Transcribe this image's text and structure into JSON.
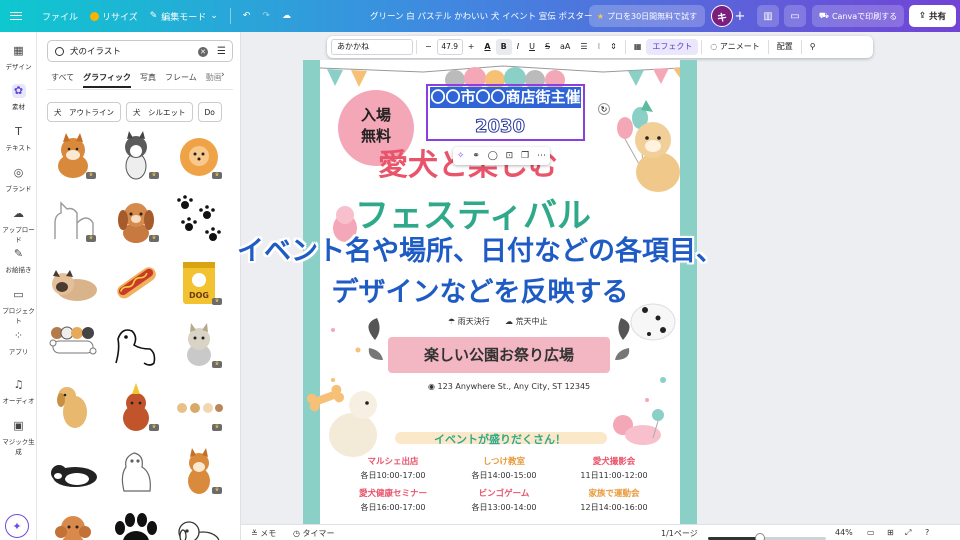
{
  "topbar": {
    "file": "ファイル",
    "resize": "リサイズ",
    "edit_mode": "編集モード",
    "doc_title": "グリーン 白 パステル かわいい 犬 イベント 宣伝 ポスター",
    "trial": "プロを30日間無料で試す",
    "avatar": "キ",
    "plus": "+",
    "print": "Canvaで印刷する",
    "share": "共有"
  },
  "rail": [
    {
      "label": "デザイン",
      "icon": "layout-icon"
    },
    {
      "label": "素材",
      "icon": "elements-icon"
    },
    {
      "label": "テキスト",
      "icon": "text-icon"
    },
    {
      "label": "ブランド",
      "icon": "brand-icon"
    },
    {
      "label": "アップロード",
      "icon": "upload-icon"
    },
    {
      "label": "お絵描き",
      "icon": "draw-icon"
    },
    {
      "label": "プロジェクト",
      "icon": "folder-icon"
    },
    {
      "label": "アプリ",
      "icon": "apps-icon"
    },
    {
      "label": "オーディオ",
      "icon": "music-icon"
    },
    {
      "label": "マジック生成",
      "icon": "magic-icon"
    }
  ],
  "panel": {
    "search_value": "犬のイラスト",
    "tabs": [
      "すべて",
      "グラフィック",
      "写真",
      "フレーム",
      "動画"
    ],
    "chips": [
      "犬　アウトライン",
      "犬　シルエット",
      "Do"
    ]
  },
  "toolbar": {
    "font": "あかかね",
    "minus": "−",
    "size": "47.9",
    "plus": "+",
    "text_color": "A",
    "bold": "B",
    "italic": "I",
    "underline": "U",
    "strike": "S",
    "case": "aA",
    "effect": "エフェクト",
    "animate": "アニメート",
    "position": "配置"
  },
  "poster": {
    "stamp_line1": "入場",
    "stamp_line2": "無料",
    "host": "〇〇市〇〇商店街主催",
    "year": "2030",
    "title1": "愛犬と楽しむ",
    "title2": "フェスティバル",
    "weather1": "雨天決行",
    "weather2": "荒天中止",
    "venue": "楽しい公園お祭り広場",
    "address": "123 Anywhere St., Any City, ST 12345",
    "events_title": "イベントが盛りだくさん！",
    "events": [
      {
        "name": "マルシェ出店",
        "time": "各日10:00-17:00",
        "color": "#e9546b"
      },
      {
        "name": "しつけ教室",
        "time": "各日14:00-15:00",
        "color": "#e89a3c"
      },
      {
        "name": "愛犬撮影会",
        "time": "11日11:00-12:00",
        "color": "#e9546b"
      },
      {
        "name": "愛犬健康セミナー",
        "time": "各日16:00-17:00",
        "color": "#e9546b"
      },
      {
        "name": "ビンゴゲーム",
        "time": "各日13:00-14:00",
        "color": "#e9546b"
      },
      {
        "name": "家族で運動会",
        "time": "12日14:00-16:00",
        "color": "#e89a3c"
      }
    ]
  },
  "overlay": {
    "line1": "イベント名や場所、日付などの各項目、",
    "line2": "デザインなどを反映する"
  },
  "bottom": {
    "notes": "メモ",
    "timer": "タイマー",
    "page": "1/1ページ",
    "zoom": "44%",
    "zoom_level": 0.44
  }
}
